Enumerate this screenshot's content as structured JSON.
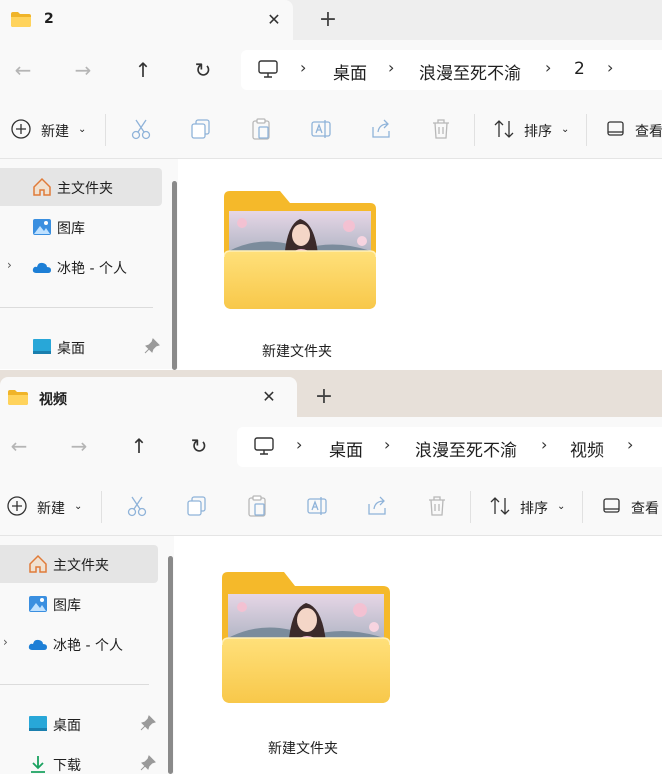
{
  "windows": [
    {
      "tab_title": "2",
      "breadcrumb": [
        "桌面",
        "浪漫至死不渝",
        "2"
      ],
      "sidebar_items": [
        "主文件夹",
        "图库",
        "冰艳 - 个人",
        "桌面"
      ],
      "folder_name": "新建文件夹"
    },
    {
      "tab_title": "视频",
      "breadcrumb": [
        "桌面",
        "浪漫至死不渝",
        "视频"
      ],
      "sidebar_items": [
        "主文件夹",
        "图库",
        "冰艳 - 个人",
        "桌面",
        "下载"
      ],
      "folder_name": "新建文件夹"
    }
  ],
  "toolbar": {
    "new_label": "新建",
    "sort_label": "排序",
    "view_label": "查看"
  },
  "icons": {
    "tab": "folder-icon",
    "close": "close-icon",
    "new_tab": "plus-icon",
    "back": "arrow-left-icon",
    "forward": "arrow-right-icon",
    "up": "arrow-up-icon",
    "refresh": "refresh-icon",
    "computer": "monitor-icon",
    "chevron": "chevron-right-icon",
    "new": "plus-circle-icon",
    "cut": "scissors-icon",
    "copy": "copy-icon",
    "paste": "clipboard-icon",
    "rename": "rename-icon",
    "share": "share-icon",
    "delete": "trash-icon",
    "sort": "sort-icon",
    "view": "view-icon",
    "home": "home-icon",
    "gallery": "gallery-icon",
    "onedrive": "cloud-icon",
    "desktop": "desktop-icon",
    "downloads": "download-icon",
    "pin": "pin-icon"
  },
  "colors": {
    "accent": "#0067c0",
    "folder": "#f5c542",
    "tab_bg_active": "#f9f9f9",
    "tabbar_bg_2": "#e7e0d9"
  }
}
